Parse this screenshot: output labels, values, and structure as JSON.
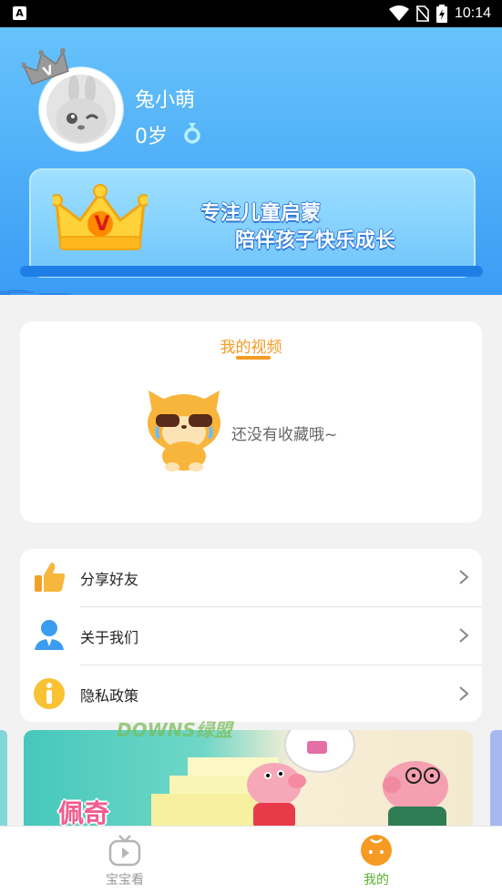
{
  "status_bar": {
    "left_badge": "A",
    "time": "10:14",
    "icons": [
      "wifi-icon",
      "sim-off-icon",
      "battery-charging-icon"
    ]
  },
  "profile": {
    "name": "兔小萌",
    "age": "0岁",
    "gender_icon": "male-icon"
  },
  "vip_banner": {
    "badge": "V",
    "line1": "专注儿童启蒙",
    "line2": "陪伴孩子快乐成长"
  },
  "videos": {
    "title": "我的视频",
    "empty_text": "还没有收藏哦~"
  },
  "menu": {
    "items": [
      {
        "label": "分享好友",
        "icon": "thumbs-up-icon"
      },
      {
        "label": "关于我们",
        "icon": "person-icon"
      },
      {
        "label": "隐私政策",
        "icon": "info-icon"
      }
    ]
  },
  "banner": {
    "title": "佩奇",
    "watermark": "DOWNS绿盟"
  },
  "bottom_nav": {
    "tabs": [
      {
        "label": "宝宝看",
        "icon": "tv-icon",
        "active": false
      },
      {
        "label": "我的",
        "icon": "face-icon",
        "active": true
      }
    ]
  },
  "colors": {
    "header_top": "#67c3fb",
    "header_bottom": "#3a9cf5",
    "accent_orange": "#f59a23",
    "active_tab": "#59b12d",
    "inactive_tab": "#999999"
  }
}
